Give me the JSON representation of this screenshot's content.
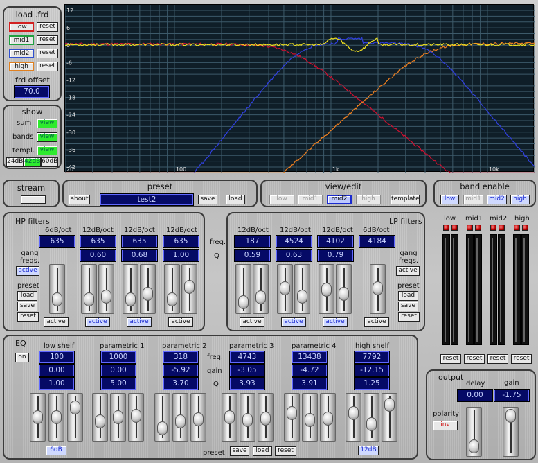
{
  "load": {
    "title": "load .frd",
    "reset": "reset",
    "bands": [
      {
        "label": "low",
        "color": "#d22020"
      },
      {
        "label": "mid1",
        "color": "#20a040"
      },
      {
        "label": "mid2",
        "color": "#3050d0"
      },
      {
        "label": "high",
        "color": "#e08020"
      }
    ],
    "offset_label": "frd offset",
    "offset_value": "70.0"
  },
  "show": {
    "title": "show",
    "rows": [
      "sum",
      "bands",
      "templ."
    ],
    "view": "view",
    "db_options": [
      "24dB",
      "42dB",
      "60dB"
    ],
    "db_selected": "42dB"
  },
  "plot": {
    "y_ticks": [
      "12",
      "6",
      "0",
      "-6",
      "-12",
      "-18",
      "-24",
      "-30",
      "-36",
      "-42"
    ],
    "x_ticks": [
      "20",
      "100",
      "1k",
      "10k"
    ],
    "x_range": [
      20,
      20000
    ],
    "y_range": [
      -42,
      12
    ]
  },
  "stream": {
    "title": "stream"
  },
  "preset": {
    "title": "preset",
    "about": "about",
    "name": "test2",
    "save": "save",
    "load": "load"
  },
  "viewedit": {
    "title": "view/edit",
    "buttons": [
      "low",
      "mid1",
      "mid2",
      "high"
    ],
    "selected": "mid2",
    "template": "template"
  },
  "band_enable": {
    "title": "band enable",
    "buttons": [
      "low",
      "mid1",
      "mid2",
      "high"
    ],
    "enabled": [
      "low",
      "mid2",
      "high"
    ]
  },
  "hp": {
    "title": "HP filters",
    "gang": "gang freqs.",
    "active": "active",
    "preset": "preset",
    "load": "load",
    "save": "save",
    "reset": "reset",
    "filters": [
      {
        "slope": "6dB/oct",
        "freq": "635",
        "q": "",
        "active": false
      },
      {
        "slope": "12dB/oct",
        "freq": "635",
        "q": "0.60",
        "active": true
      },
      {
        "slope": "12dB/oct",
        "freq": "635",
        "q": "0.68",
        "active": true
      },
      {
        "slope": "12dB/oct",
        "freq": "635",
        "q": "1.00",
        "active": false
      }
    ]
  },
  "mid_labels": {
    "freq": "freq.",
    "q": "Q"
  },
  "lp": {
    "title": "LP filters",
    "gang": "gang freqs.",
    "active": "active",
    "preset": "preset",
    "load": "load",
    "save": "save",
    "reset": "reset",
    "filters": [
      {
        "slope": "12dB/oct",
        "freq": "187",
        "q": "0.59",
        "active": false
      },
      {
        "slope": "12dB/oct",
        "freq": "4524",
        "q": "0.63",
        "active": true
      },
      {
        "slope": "12dB/oct",
        "freq": "4102",
        "q": "0.79",
        "active": true
      },
      {
        "slope": "6dB/oct",
        "freq": "4184",
        "q": "",
        "active": false
      }
    ]
  },
  "meters": {
    "labels": [
      "low",
      "mid1",
      "mid2",
      "high"
    ],
    "reset": "reset"
  },
  "eq": {
    "title": "EQ",
    "on": "on",
    "labels": {
      "freq": "freq.",
      "gain": "gain",
      "q": "Q"
    },
    "shelf_low_db": "6dB",
    "shelf_high_db": "12dB",
    "preset": "preset",
    "save": "save",
    "load": "load",
    "reset": "reset",
    "bands": [
      {
        "name": "low shelf",
        "freq": "100",
        "gain": "0.00",
        "q": "1.00"
      },
      {
        "name": "parametric 1",
        "freq": "1000",
        "gain": "0.00",
        "q": "5.00"
      },
      {
        "name": "parametric 2",
        "freq": "318",
        "gain": "-5.92",
        "q": "3.70"
      },
      {
        "name": "parametric 3",
        "freq": "4743",
        "gain": "-3.05",
        "q": "3.93"
      },
      {
        "name": "parametric 4",
        "freq": "13438",
        "gain": "-4.72",
        "q": "3.91"
      },
      {
        "name": "high shelf",
        "freq": "7792",
        "gain": "-12.15",
        "q": "1.25"
      }
    ]
  },
  "output": {
    "title": "output",
    "delay": "delay",
    "delay_value": "0.00",
    "gain": "gain",
    "gain_value": "-1.75",
    "polarity": "polarity",
    "inv": "inv"
  },
  "colors": {
    "sum": "#f0e020",
    "low": "#d01030",
    "mid": "#3040e0",
    "high": "#f08020"
  }
}
